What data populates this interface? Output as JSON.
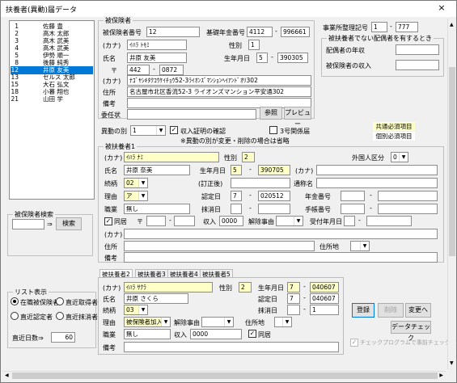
{
  "window": {
    "title": "扶養者(異動)届データ",
    "close_icon": "×"
  },
  "list": {
    "items": [
      {
        "num": "1",
        "name": "佐藤 豊"
      },
      {
        "num": "2",
        "name": "高木 太郎"
      },
      {
        "num": "3",
        "name": "高木 武美"
      },
      {
        "num": "4",
        "name": "高木 武美"
      },
      {
        "num": "5",
        "name": "伊勢 順一"
      },
      {
        "num": "8",
        "name": "後藤 純秀"
      },
      {
        "num": "12",
        "name": "井原 友美"
      },
      {
        "num": "13",
        "name": "セルス 太郎"
      },
      {
        "num": "15",
        "name": "大石 弘文"
      },
      {
        "num": "18",
        "name": "小暮 翔也"
      },
      {
        "num": "21",
        "name": "山田 学"
      }
    ],
    "selected": 6
  },
  "search": {
    "title": "被保険者検索",
    "arrow": "⇒",
    "button": "検索"
  },
  "list_view": {
    "title": "リスト表示",
    "options": [
      "在職被保険者",
      "直近取得者",
      "直近認定者",
      "直近抹消者"
    ],
    "selected": 0,
    "days_label": "直近日数⇒",
    "days": "60"
  },
  "insured": {
    "title": "被保険者",
    "num_label": "被保険者番号",
    "num": "12",
    "pension_label": "基礎年金番号",
    "pension1": "4112",
    "pension2": "996661",
    "kana_label": "(カナ)",
    "kana": "ｲﾊﾗ ﾄﾓﾐ",
    "gender_label": "性別",
    "gender": "1",
    "name_label": "氏名",
    "name": "井原 友美",
    "birth_label": "生年月日",
    "birth_era": "5",
    "birth_date": "390305",
    "zip_mark": "〒",
    "zip1": "442",
    "zip2": "0872",
    "addr_kana_label": "(カナ)",
    "addr_kana": "ﾅｺﾞﾔｼｷﾀｸｺｳｹｲﾁｮｳ52-3ﾗｲｵﾝｽﾞﾏﾝｼｮﾝﾍｲｱﾝﾄﾞｵﾘ302",
    "addr_label": "住所",
    "addr": "名古屋市北区香流52-3 ライオンズマンション平安通302",
    "memo_label": "備考",
    "memo": "",
    "delegation_label": "委任状",
    "browse": "参照",
    "preview": "プレビュー"
  },
  "office": {
    "label": "事業所整理記号",
    "code1": "1",
    "code2": "777"
  },
  "spouse": {
    "title": "被扶養者でない配偶者を有するとき",
    "income_label": "配偶者の年収",
    "insured_income_label": "被保険者の収入"
  },
  "change": {
    "label": "異動の別",
    "value": "1",
    "income_check": "収入証明の確認",
    "kind3": "3号関係届",
    "note": "※異動の別が変更・削除の場合は省略"
  },
  "legend": {
    "common": "共通必須項目",
    "individual": "個別必須項目"
  },
  "dep1": {
    "title": "被扶養者1",
    "kana_label": "(カナ)",
    "kana": "ｲﾊﾗ ﾅﾐ",
    "gender_label": "性別",
    "gender": "2",
    "foreign_label": "外国人区分",
    "foreign": "0",
    "name_label": "氏名",
    "name": "井原 奈美",
    "birth_label": "生年月日",
    "birth_era": "5",
    "birth_date": "390705",
    "kana2_label": "(カナ)",
    "rel_label": "続柄",
    "rel": "02",
    "correct_label": "(訂正後)",
    "alias_label": "通称名",
    "reason_label": "理由",
    "reason": "ア",
    "cert_label": "認定日",
    "cert_era": "7",
    "cert_date": "020512",
    "pension_label": "年金番号",
    "job_label": "職業",
    "job": "無し",
    "del_label": "抹消日",
    "handbook_label": "手帳番号",
    "same_label": "同居",
    "zip_mark": "〒",
    "income_label": "収入",
    "income": "0000",
    "cancel_label": "解除事由",
    "recv_label": "受付年月日",
    "addr_kana_label": "(カナ)",
    "addr_label": "住所",
    "residence_label": "住所地",
    "memo_label": "備考"
  },
  "tabs": [
    "被扶養者2",
    "被扶養者3",
    "被扶養者4",
    "被扶養者5"
  ],
  "dep2": {
    "kana_label": "(カナ)",
    "kana": "ｲﾊﾗ ｻｸﾗ",
    "gender_label": "性別",
    "gender": "2",
    "birth_label": "生年月日",
    "birth_era": "7",
    "birth_date": "040607",
    "name_label": "氏名",
    "name": "井原 さくら",
    "cert_label": "認定日",
    "cert_era": "7",
    "cert_date": "040607",
    "rel_label": "続柄",
    "rel": "03",
    "del_label": "抹消日",
    "del_date": "1",
    "reason_label": "理由",
    "reason": "被保険者加入",
    "cancel_label": "解除事由",
    "residence_label": "住所地",
    "job_label": "職業",
    "job": "無し",
    "income_label": "収入",
    "income": "0000",
    "same_label": "同居",
    "memo_label": "備考"
  },
  "buttons": {
    "register": "登録",
    "delete": "削除",
    "change": "変更へ",
    "check": "データチェック",
    "auto_check": "チェックプログラムで事前チェックする。"
  }
}
